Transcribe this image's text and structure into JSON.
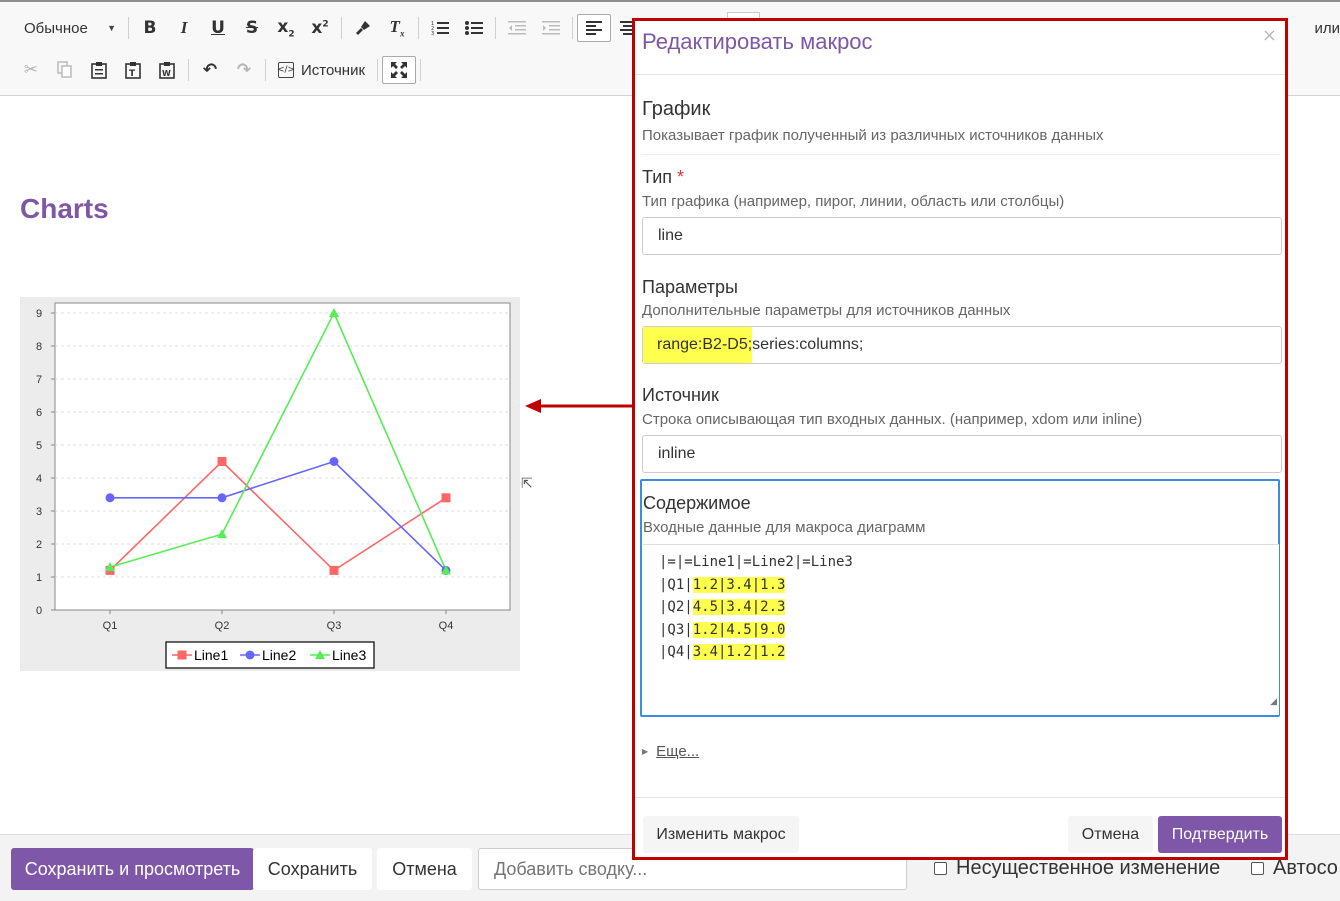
{
  "toolbar": {
    "format_select": "Обычное",
    "source_label": "Источник",
    "right_text": "или"
  },
  "page": {
    "title": "Charts"
  },
  "chart_data": {
    "type": "line",
    "categories": [
      "Q1",
      "Q2",
      "Q3",
      "Q4"
    ],
    "series": [
      {
        "name": "Line1",
        "values": [
          1.2,
          4.5,
          1.2,
          3.4
        ],
        "color": "#ff6666",
        "marker": "square"
      },
      {
        "name": "Line2",
        "values": [
          3.4,
          3.4,
          4.5,
          1.2
        ],
        "color": "#6666ff",
        "marker": "circle"
      },
      {
        "name": "Line3",
        "values": [
          1.3,
          2.3,
          9.0,
          1.2
        ],
        "color": "#55ee55",
        "marker": "triangle"
      }
    ],
    "ylim": [
      0,
      9
    ],
    "yticks": [
      "0",
      "1",
      "2",
      "3",
      "4",
      "5",
      "6",
      "7",
      "8",
      "9"
    ],
    "grid": true,
    "legend_position": "bottom"
  },
  "modal": {
    "title": "Редактировать макрос",
    "close": "×",
    "macro_name": "График",
    "macro_desc": "Показывает график полученный из различных источников данных",
    "type_label": "Тип",
    "type_required": "*",
    "type_desc": "Тип графика (например, пирог, линии, область или столбцы)",
    "type_value": "line",
    "params_label": "Параметры",
    "params_desc": "Дополнительные параметры для источников данных",
    "params_value_highlight": "range:B2-D5;",
    "params_value_rest": "series:columns;",
    "source_label": "Источник",
    "source_desc": "Строка описывающая тип входных данных. (например, xdom или inline)",
    "source_value": "inline",
    "content_label": "Содержимое",
    "content_desc": "Входные данные для макроса диаграмм",
    "content_lines": [
      {
        "pre": "|=|=Line1|=Line2|=Line3",
        "hl": ""
      },
      {
        "pre": "|Q1|",
        "hl": "1.2|3.4|1.3"
      },
      {
        "pre": "|Q2|",
        "hl": "4.5|3.4|2.3"
      },
      {
        "pre": "|Q3|",
        "hl": "1.2|4.5|9.0"
      },
      {
        "pre": "|Q4|",
        "hl": "3.4|1.2|1.2"
      }
    ],
    "more_link": "Еще...",
    "change_button": "Изменить макрос",
    "cancel_button": "Отмена",
    "confirm_button": "Подтвердить"
  },
  "bottom": {
    "save_view": "Сохранить и просмотреть",
    "save": "Сохранить",
    "cancel": "Отмена",
    "summary_placeholder": "Добавить сводку...",
    "minor_change": "Несущественное изменение",
    "autosave": "Автосо"
  }
}
